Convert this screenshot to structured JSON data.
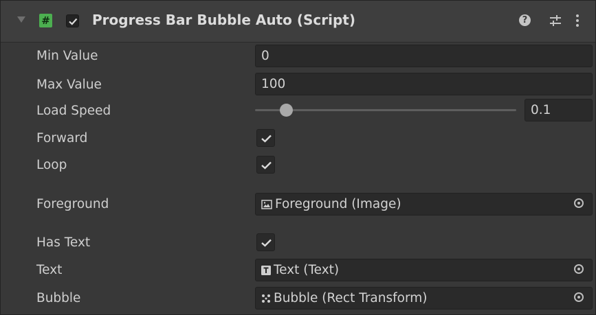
{
  "component": {
    "title": "Progress Bar Bubble Auto (Script)",
    "script_icon": "script-hash-icon",
    "enabled": true,
    "accent_color": "#4caf50"
  },
  "header_icons": [
    "help-icon",
    "preset-sliders-icon",
    "more-vertical-icon"
  ],
  "fields": {
    "min_value": {
      "label": "Min Value",
      "value": "0"
    },
    "max_value": {
      "label": "Max Value",
      "value": "100"
    },
    "load_speed": {
      "label": "Load Speed",
      "value": "0.1",
      "slider_fraction": 0.12
    },
    "forward": {
      "label": "Forward",
      "checked": true
    },
    "loop": {
      "label": "Loop",
      "checked": true
    },
    "foreground": {
      "label": "Foreground",
      "value": "Foreground (Image)",
      "icon": "image-icon"
    },
    "has_text": {
      "label": "Has Text",
      "checked": true
    },
    "text": {
      "label": "Text",
      "value": "Text (Text)",
      "icon": "text-component-icon"
    },
    "bubble": {
      "label": "Bubble",
      "value": "Bubble (Rect Transform)",
      "icon": "rect-transform-icon"
    }
  }
}
